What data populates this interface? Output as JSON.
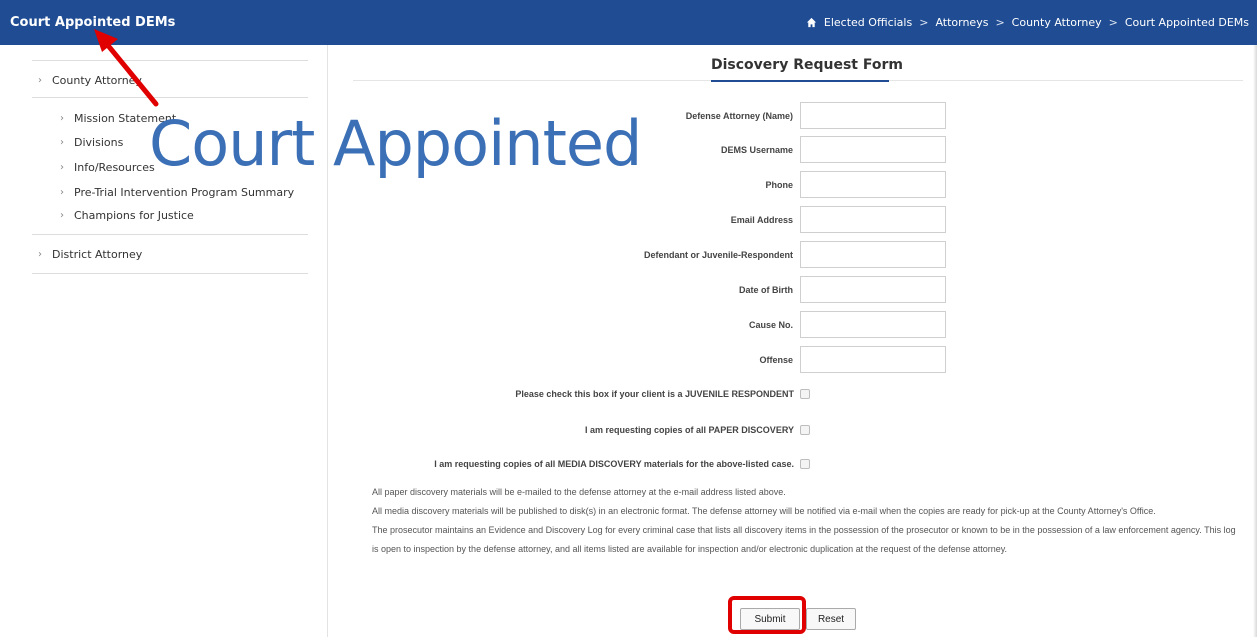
{
  "header": {
    "title": "Court Appointed DEMs",
    "breadcrumb": [
      "Elected Officials",
      "Attorneys",
      "County Attorney",
      "Court Appointed DEMs"
    ],
    "separator": ">"
  },
  "sidebar": {
    "items": [
      {
        "label": "County Attorney"
      },
      {
        "label": "Mission Statement"
      },
      {
        "label": "Divisions"
      },
      {
        "label": "Info/Resources"
      },
      {
        "label": "Pre-Trial Intervention Program Summary"
      },
      {
        "label": "Champions for Justice"
      },
      {
        "label": "District Attorney"
      }
    ]
  },
  "form": {
    "title": "Discovery Request Form",
    "fields": [
      {
        "label": "Defense Attorney (Name)",
        "value": ""
      },
      {
        "label": "DEMS Username",
        "value": ""
      },
      {
        "label": "Phone",
        "value": ""
      },
      {
        "label": "Email Address",
        "value": ""
      },
      {
        "label": "Defendant or Juvenile-Respondent",
        "value": ""
      },
      {
        "label": "Date of Birth",
        "value": ""
      },
      {
        "label": "Cause No.",
        "value": ""
      },
      {
        "label": "Offense",
        "value": ""
      }
    ],
    "checks": [
      {
        "label": "Please check this box if your client is a JUVENILE RESPONDENT"
      },
      {
        "label": "I am requesting copies of all PAPER DISCOVERY"
      },
      {
        "label": "I am requesting copies of all MEDIA DISCOVERY materials for the above-listed case."
      }
    ],
    "notes": [
      "All paper discovery materials will be e-mailed to the defense attorney at the e-mail address listed above.",
      "All media discovery materials will be published to disk(s) in an electronic format. The defense attorney will be notified via e-mail when the copies are ready for pick-up at the County Attorney's Office.",
      "The prosecutor maintains an Evidence and Discovery Log for every criminal case that lists all discovery items in the possession of the prosecutor or known to be in the possession of a law enforcement agency. This log is open to inspection by the defense attorney, and all items listed are available for inspection and/or electronic duplication at the request of the defense attorney."
    ],
    "submit_label": "Submit",
    "reset_label": "Reset"
  },
  "annotation": {
    "text": "Court Appointed",
    "color": "#3b6fb6",
    "highlight_color": "#e00000"
  },
  "colors": {
    "header_bg": "#1f4c93"
  }
}
